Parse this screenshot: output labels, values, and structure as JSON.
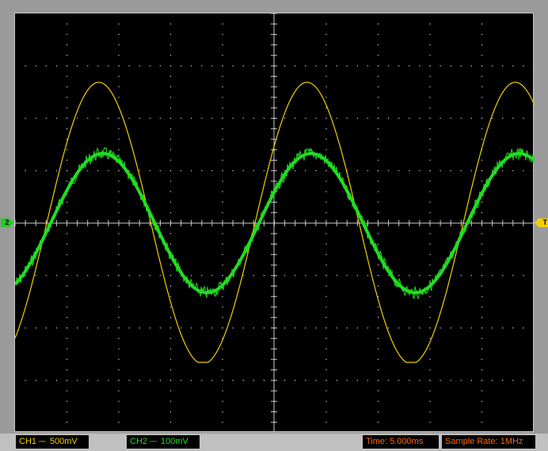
{
  "channels": {
    "ch1": {
      "label": "CH1",
      "coupling_icon": "dc-coupling-icon",
      "scale": "500mV",
      "color": "#f0d000"
    },
    "ch2": {
      "label": "CH2",
      "coupling_icon": "dc-coupling-icon",
      "scale": "100mV",
      "color": "#22dd22"
    }
  },
  "markers": {
    "ch2": "2",
    "trigger": "T"
  },
  "timebase": {
    "text": "Time: 5.000ms"
  },
  "sample_rate": {
    "text": "Sample Rate: 1MHz"
  },
  "colors": {
    "screen_bg": "#000000",
    "grid": "#c8c8c8",
    "status_text": "#ff6a00"
  }
}
